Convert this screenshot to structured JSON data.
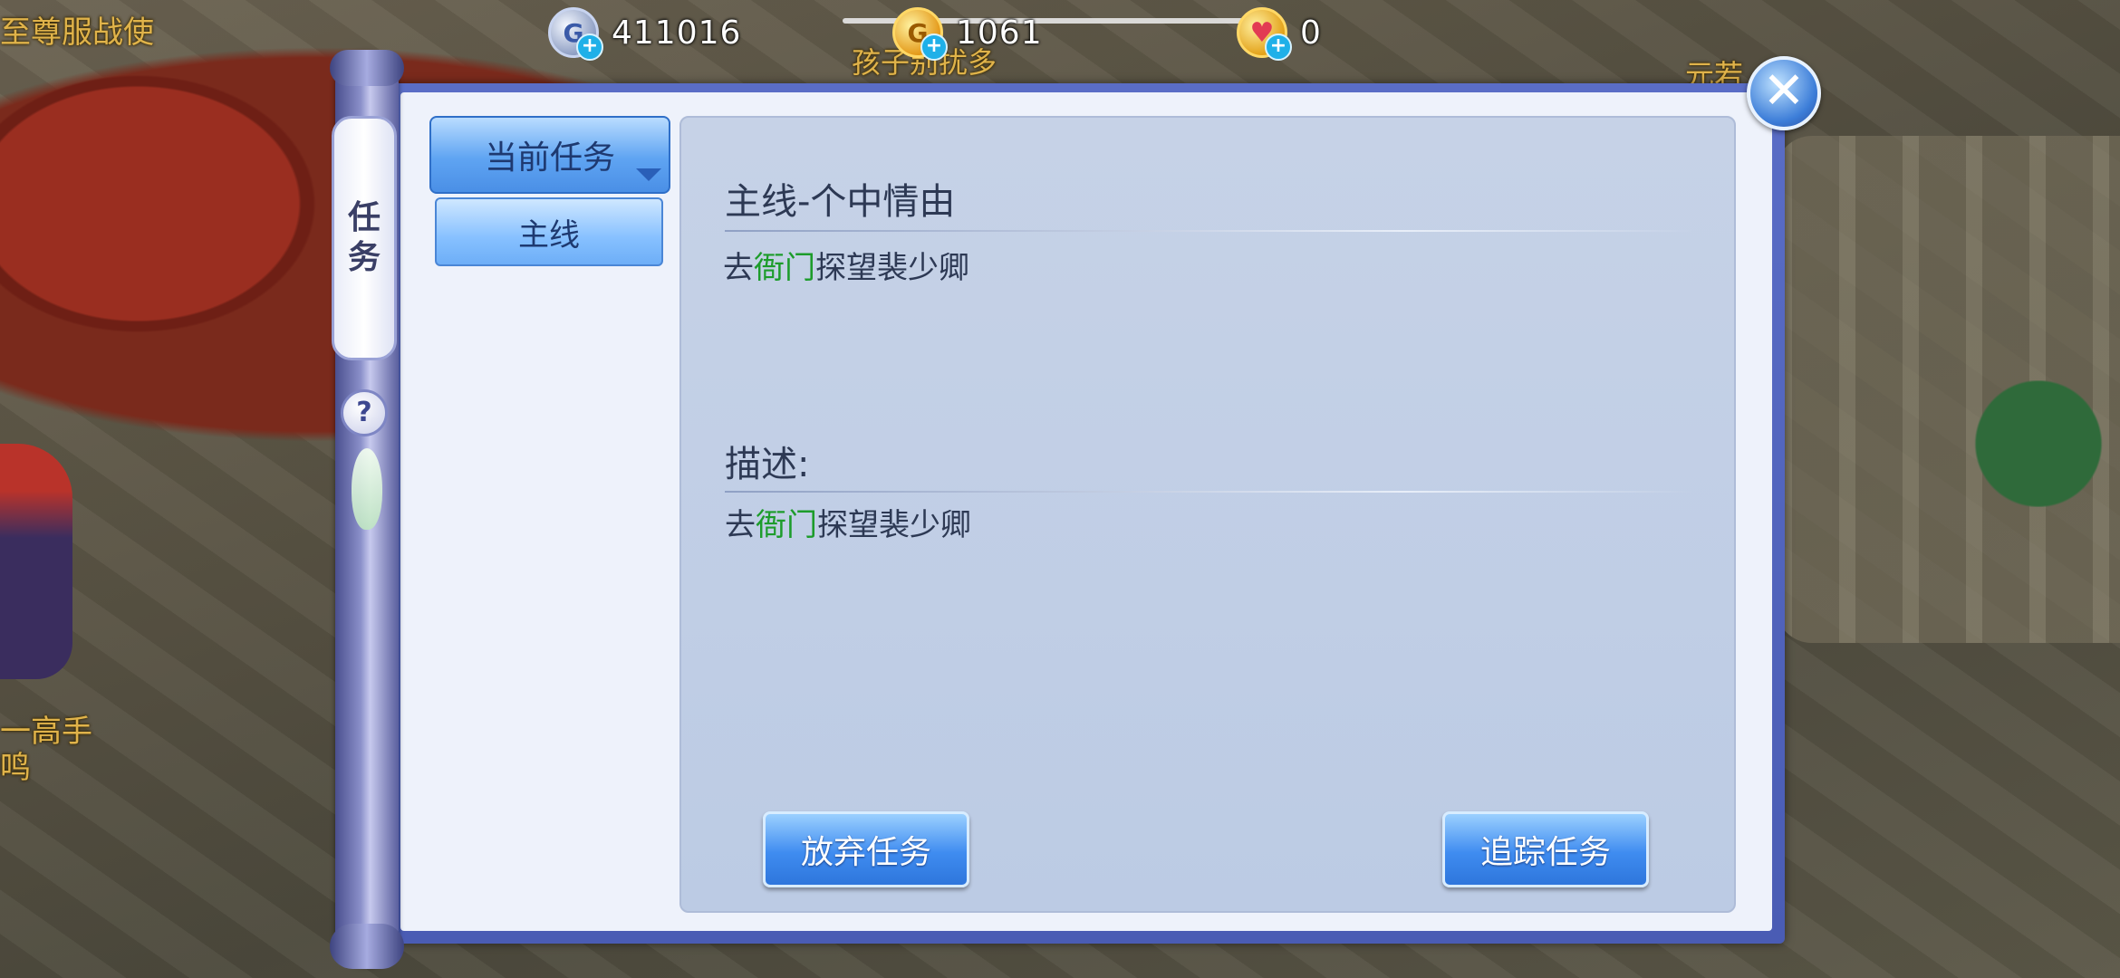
{
  "background": {
    "left_top_text": "至尊服战使",
    "left_mid_text_1": "一高手",
    "left_mid_text_2": "鸣",
    "center_npc_text": "孩子别扰多",
    "right_npc_text": "元若"
  },
  "currencies": [
    {
      "icon": "silver-coin-icon",
      "symbol": "G",
      "value": "411016"
    },
    {
      "icon": "gold-coin-icon",
      "symbol": "G",
      "value": "1061"
    },
    {
      "icon": "heart-coin-icon",
      "symbol": "♥",
      "value": "0"
    }
  ],
  "plus_symbol": "+",
  "close_symbol": "✕",
  "side_tab": {
    "label_1": "任",
    "label_2": "务"
  },
  "help_symbol": "?",
  "tabs": {
    "current": "当前任务",
    "main": "主线"
  },
  "quest": {
    "title": "主线-个中情由",
    "objective_prefix": "去",
    "objective_highlight": "衙门",
    "objective_suffix": "探望裴少卿",
    "description_label": "描述:",
    "description_prefix": "去",
    "description_highlight": "衙门",
    "description_suffix": "探望裴少卿"
  },
  "buttons": {
    "abandon": "放弃任务",
    "track": "追踪任务"
  },
  "colors": {
    "highlight": "#1d9c2b",
    "panel_border": "#4a5cb4",
    "button": "#3f8cf0"
  }
}
